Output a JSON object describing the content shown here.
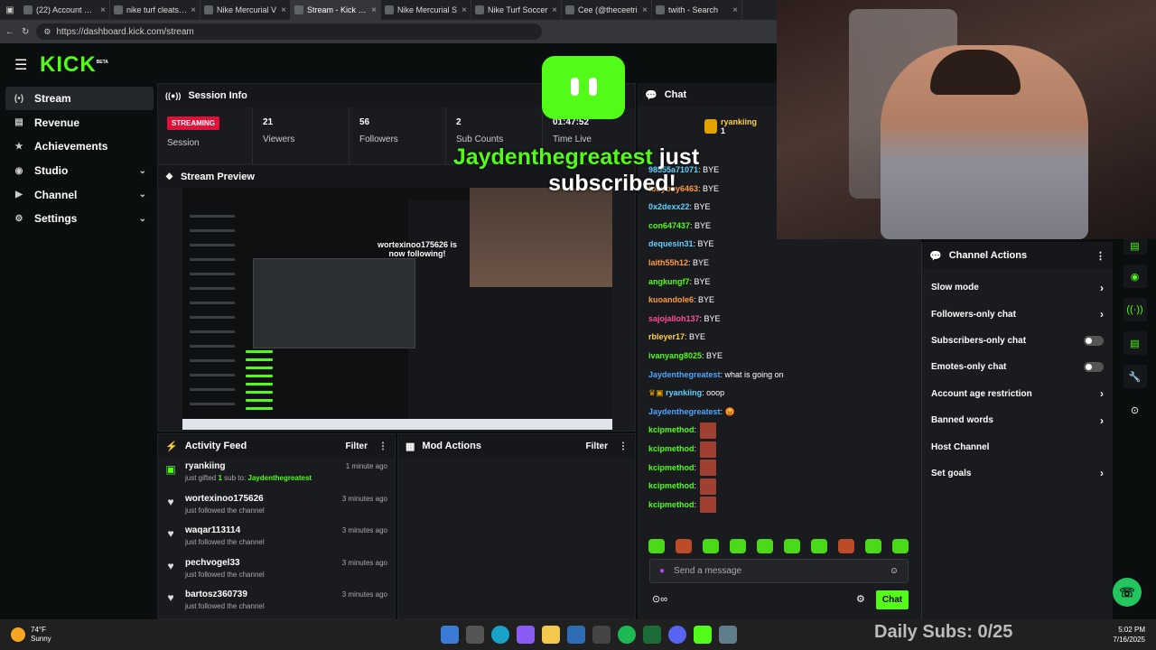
{
  "browser": {
    "tabs": [
      {
        "title": "(22) Account Setti",
        "active": false
      },
      {
        "title": "nike turf cleats so",
        "active": false
      },
      {
        "title": "Nike Mercurial V",
        "active": false
      },
      {
        "title": "Stream - Kick Da",
        "active": true
      },
      {
        "title": "Nike Mercurial S",
        "active": false
      },
      {
        "title": "Nike Turf Soccer",
        "active": false
      },
      {
        "title": "Cee (@theceetri",
        "active": false
      },
      {
        "title": "twith - Search",
        "active": false
      }
    ],
    "url": "https://dashboard.kick.com/stream"
  },
  "logo": {
    "text": "KICK",
    "badge": "BETA"
  },
  "sidebar": {
    "items": [
      {
        "label": "Stream",
        "icon": "stream-icon",
        "active": true
      },
      {
        "label": "Revenue",
        "icon": "revenue-icon"
      },
      {
        "label": "Achievements",
        "icon": "trophy-icon"
      },
      {
        "label": "Studio",
        "icon": "studio-icon",
        "expandable": true
      },
      {
        "label": "Channel",
        "icon": "channel-icon",
        "expandable": true
      },
      {
        "label": "Settings",
        "icon": "gear-icon",
        "expandable": true
      }
    ]
  },
  "session": {
    "title": "Session Info",
    "badge": "STREAMING",
    "session_label": "Session",
    "stats": [
      {
        "value": "21",
        "label": "Viewers"
      },
      {
        "value": "56",
        "label": "Followers"
      },
      {
        "value": "2",
        "label": "Sub Counts"
      },
      {
        "value": "01:47:52",
        "label": "Time Live"
      }
    ]
  },
  "preview": {
    "title": "Stream Preview",
    "follow_text": "wortexinoo175626 is now following!"
  },
  "overlay": {
    "name": "Jaydenthegreatest",
    "text1": " just",
    "text2": "subscribed!",
    "daily": "Daily Subs: 0/25"
  },
  "activity": {
    "title": "Activity Feed",
    "filter": "Filter",
    "items": [
      {
        "name": "ryankiing",
        "sub_pre": "just gifted ",
        "sub_count": "1",
        "sub_mid": " sub to: ",
        "sub_target": "Jaydenthegreatest",
        "time": "1 minute ago",
        "icon": "gift-icon"
      },
      {
        "name": "wortexinoo175626",
        "sub": "just followed the channel",
        "time": "3 minutes ago",
        "icon": "heart-icon"
      },
      {
        "name": "waqar113114",
        "sub": "just followed the channel",
        "time": "3 minutes ago",
        "icon": "heart-icon"
      },
      {
        "name": "pechvogel33",
        "sub": "just followed the channel",
        "time": "3 minutes ago",
        "icon": "heart-icon"
      },
      {
        "name": "bartosz360739",
        "sub": "just followed the channel",
        "time": "3 minutes ago",
        "icon": "heart-icon"
      }
    ]
  },
  "mod_actions": {
    "title": "Mod Actions",
    "filter": "Filter"
  },
  "chat": {
    "title": "Chat",
    "pinned_user": "ryankiing",
    "pinned_count": "1",
    "messages": [
      {
        "user": "98555a71071",
        "color": "#5fd0ff",
        "text": ": BYE"
      },
      {
        "user": "tobyboy6463",
        "color": "#ff9b3f",
        "text": ": BYE"
      },
      {
        "user": "0x2dexx22",
        "color": "#5fd0ff",
        "text": ": BYE"
      },
      {
        "user": "con647437",
        "color": "#53fc18",
        "text": ": BYE"
      },
      {
        "user": "dequesin31",
        "color": "#5fd0ff",
        "text": ": BYE"
      },
      {
        "user": "laith55h12",
        "color": "#ff9b3f",
        "text": ": BYE"
      },
      {
        "user": "angkungf7",
        "color": "#53fc18",
        "text": ": BYE"
      },
      {
        "user": "kuoandole6",
        "color": "#ff9b3f",
        "text": ": BYE"
      },
      {
        "user": "sajojalloh137",
        "color": "#ff4f9b",
        "text": ": BYE"
      },
      {
        "user": "rbleyer17",
        "color": "#ffd23f",
        "text": ": BYE"
      },
      {
        "user": "ivanyang8025",
        "color": "#53fc18",
        "text": ": BYE"
      },
      {
        "user": "Jaydenthegreatest",
        "color": "#4da6ff",
        "text": ": what is going on"
      },
      {
        "user": "ryankiing",
        "color": "#5fd0ff",
        "text": ": ooop"
      },
      {
        "user": "Jaydenthegreatest",
        "color": "#4da6ff",
        "text": ": 😡"
      },
      {
        "user": "kcipmethod",
        "color": "#53fc18",
        "text": ":",
        "emote": true
      },
      {
        "user": "kcipmethod",
        "color": "#53fc18",
        "text": ":",
        "emote": true
      },
      {
        "user": "kcipmethod",
        "color": "#53fc18",
        "text": ":",
        "emote": true
      },
      {
        "user": "kcipmethod",
        "color": "#53fc18",
        "text": ":",
        "emote": true
      },
      {
        "user": "kcipmethod",
        "color": "#53fc18",
        "text": ":",
        "emote": true
      }
    ],
    "placeholder": "Send a message",
    "send": "Chat"
  },
  "channel_actions": {
    "title": "Channel Actions",
    "items": [
      {
        "label": "Slow mode",
        "kind": "chevron"
      },
      {
        "label": "Followers-only chat",
        "kind": "chevron"
      },
      {
        "label": "Subscribers-only chat",
        "kind": "toggle"
      },
      {
        "label": "Emotes-only chat",
        "kind": "toggle"
      },
      {
        "label": "Account age restriction",
        "kind": "chevron"
      },
      {
        "label": "Banned words",
        "kind": "chevron"
      },
      {
        "label": "Host Channel",
        "kind": "none"
      },
      {
        "label": "Set goals",
        "kind": "chevron"
      }
    ]
  },
  "taskbar": {
    "weather_temp": "74°F",
    "weather_desc": "Sunny",
    "time": "5:02 PM",
    "date": "7/16/2025"
  },
  "colors": {
    "accent": "#53fc18",
    "streaming": "#e0103b"
  }
}
